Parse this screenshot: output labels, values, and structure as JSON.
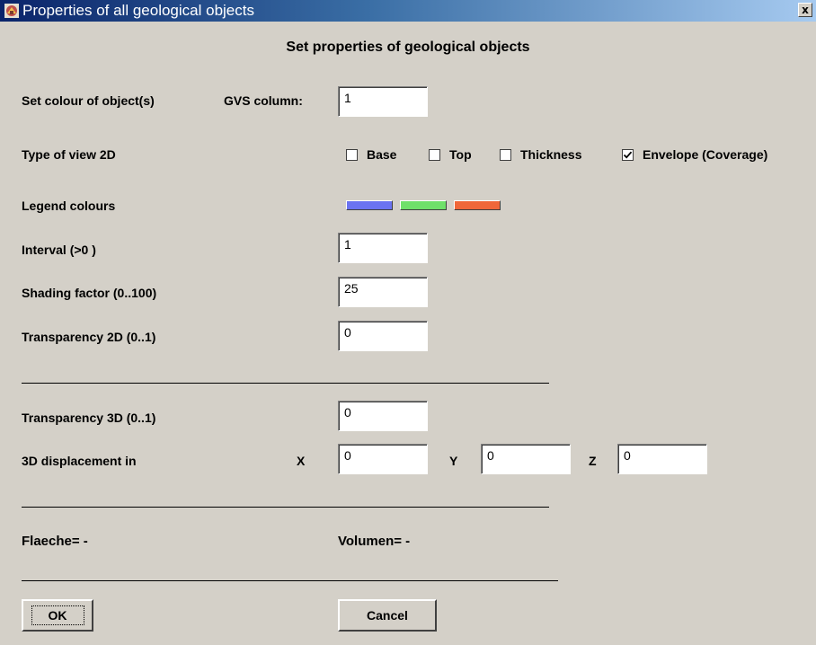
{
  "window": {
    "title": "Properties of all geological objects",
    "close_glyph": "x"
  },
  "dialog": {
    "heading": "Set properties of geological objects",
    "set_colour_label": "Set colour of object(s)",
    "gvs_column_label": "GVS column:",
    "gvs_column_value": "1",
    "view_type_label": "Type of view 2D",
    "view_options": [
      {
        "label": "Base",
        "checked": false
      },
      {
        "label": "Top",
        "checked": false
      },
      {
        "label": "Thickness",
        "checked": false
      },
      {
        "label": "Envelope (Coverage)",
        "checked": true
      }
    ],
    "legend_label": "Legend colours",
    "legend_colors": [
      "#6b73f0",
      "#6fe06a",
      "#f0673a"
    ],
    "interval_label": "Interval (>0 )",
    "interval_value": "1",
    "shading_label": "Shading factor (0..100)",
    "shading_value": "25",
    "transparency2d_label": "Transparency 2D (0..1)",
    "transparency2d_value": "0",
    "transparency3d_label": "Transparency 3D (0..1)",
    "transparency3d_value": "0",
    "displacement_label": "3D displacement in",
    "x_label": "X",
    "x_value": "0",
    "y_label": "Y",
    "y_value": "0",
    "z_label": "Z",
    "z_value": "0",
    "flaeche_text": "Flaeche= -",
    "volumen_text": "Volumen= -"
  },
  "buttons": {
    "ok_label": "OK",
    "cancel_label": "Cancel"
  },
  "icons": {
    "app": "app-window-icon",
    "close": "close-icon",
    "check": "checkmark-icon"
  }
}
